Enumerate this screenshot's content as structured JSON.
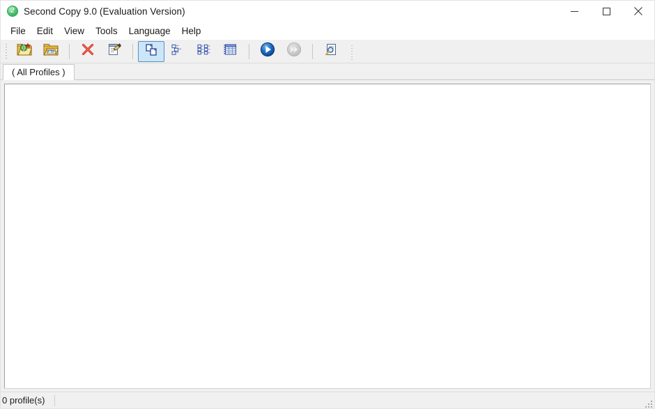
{
  "window": {
    "title": "Second Copy 9.0 (Evaluation Version)",
    "app_icon": "second-copy-logo-icon",
    "controls": {
      "minimize": "minimize-icon",
      "maximize": "maximize-icon",
      "close": "close-icon"
    }
  },
  "menubar": {
    "items": [
      {
        "label": "File"
      },
      {
        "label": "Edit"
      },
      {
        "label": "View"
      },
      {
        "label": "Tools"
      },
      {
        "label": "Language"
      },
      {
        "label": "Help"
      }
    ]
  },
  "toolbar": {
    "buttons": [
      {
        "id": "new-profile",
        "icon": "new-profile-folder-icon",
        "label": "New Profile",
        "state": "enabled"
      },
      {
        "id": "new-ftp-profile",
        "icon": "ftp-folder-icon",
        "label": "New FTP Profile",
        "state": "enabled"
      },
      {
        "id": "delete-profile",
        "icon": "delete-x-icon",
        "label": "Delete Profile",
        "state": "enabled"
      },
      {
        "id": "profile-properties",
        "icon": "profile-properties-icon",
        "label": "Properties",
        "state": "enabled"
      },
      {
        "id": "view-large-icons",
        "icon": "large-icons-view-icon",
        "label": "Large Icons",
        "state": "active"
      },
      {
        "id": "view-small-icons",
        "icon": "small-icons-view-icon",
        "label": "Small Icons",
        "state": "enabled"
      },
      {
        "id": "view-list",
        "icon": "list-view-icon",
        "label": "List",
        "state": "enabled"
      },
      {
        "id": "view-details",
        "icon": "details-view-icon",
        "label": "Details",
        "state": "enabled"
      },
      {
        "id": "run-profile",
        "icon": "run-play-icon",
        "label": "Run",
        "state": "enabled"
      },
      {
        "id": "run-all-profiles",
        "icon": "run-all-fast-forward-icon",
        "label": "Run All",
        "state": "disabled"
      },
      {
        "id": "view-log",
        "icon": "view-log-magnifier-icon",
        "label": "View Log",
        "state": "enabled"
      }
    ]
  },
  "tabs": {
    "items": [
      {
        "label": "(  All Profiles  )",
        "selected": true
      }
    ]
  },
  "main": {
    "profiles": [],
    "empty_text": ""
  },
  "statusbar": {
    "profile_count_text": "0 profile(s)"
  },
  "colors": {
    "accent_blue": "#1b6bb5",
    "active_tool_bg": "#cde6f7",
    "active_tool_border": "#4f90c8",
    "window_bg": "#f0f0f0",
    "pane_bg": "#ffffff",
    "delete_red": "#d63a2a",
    "folder_yellow": "#f3c44a",
    "logo_green": "#2aa354"
  }
}
